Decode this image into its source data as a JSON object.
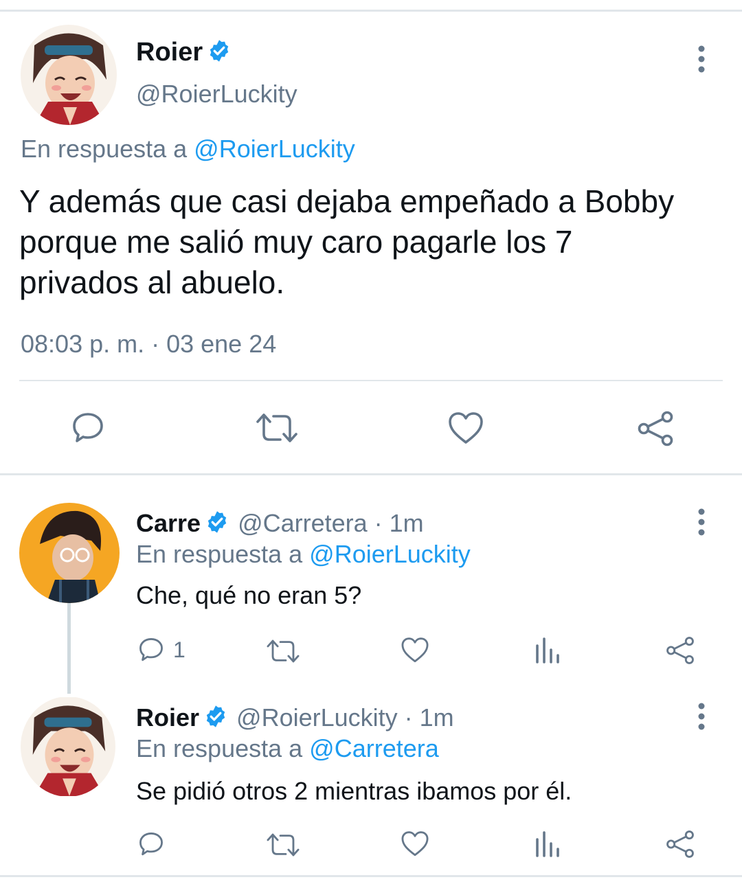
{
  "main_tweet": {
    "author_name": "Roier",
    "author_handle": "@RoierLuckity",
    "reply_prefix": "En respuesta a",
    "reply_to": "@RoierLuckity",
    "text_lines": [
      "Y además que casi dejaba empeñado a Bobby",
      "porque me salió muy caro pagarle los 7",
      "privados al abuelo."
    ],
    "timestamp": "08:03 p. m. · 03 ene 24",
    "actions": [
      "reply-icon",
      "retweet-icon",
      "like-icon",
      "share-icon"
    ]
  },
  "replies": [
    {
      "author_name": "Carre",
      "meta": "@Carretera · 1m",
      "reply_prefix": "En respuesta a",
      "reply_to": "@RoierLuckity",
      "text": "Che, qué no eran 5?",
      "reply_count": "1",
      "actions": [
        "reply-icon",
        "retweet-icon",
        "like-icon",
        "views-icon",
        "share-icon"
      ]
    },
    {
      "author_name": "Roier",
      "meta": "@RoierLuckity · 1m",
      "reply_prefix": "En respuesta a",
      "reply_to": "@Carretera",
      "text": "Se pidió otros 2 mientras ibamos por él.",
      "reply_count": "",
      "actions": [
        "reply-icon",
        "retweet-icon",
        "like-icon",
        "views-icon",
        "share-icon"
      ]
    }
  ],
  "colors": {
    "accent": "#1d9bf0",
    "muted": "#65778a",
    "carre_avatar_bg": "#f5a623"
  }
}
